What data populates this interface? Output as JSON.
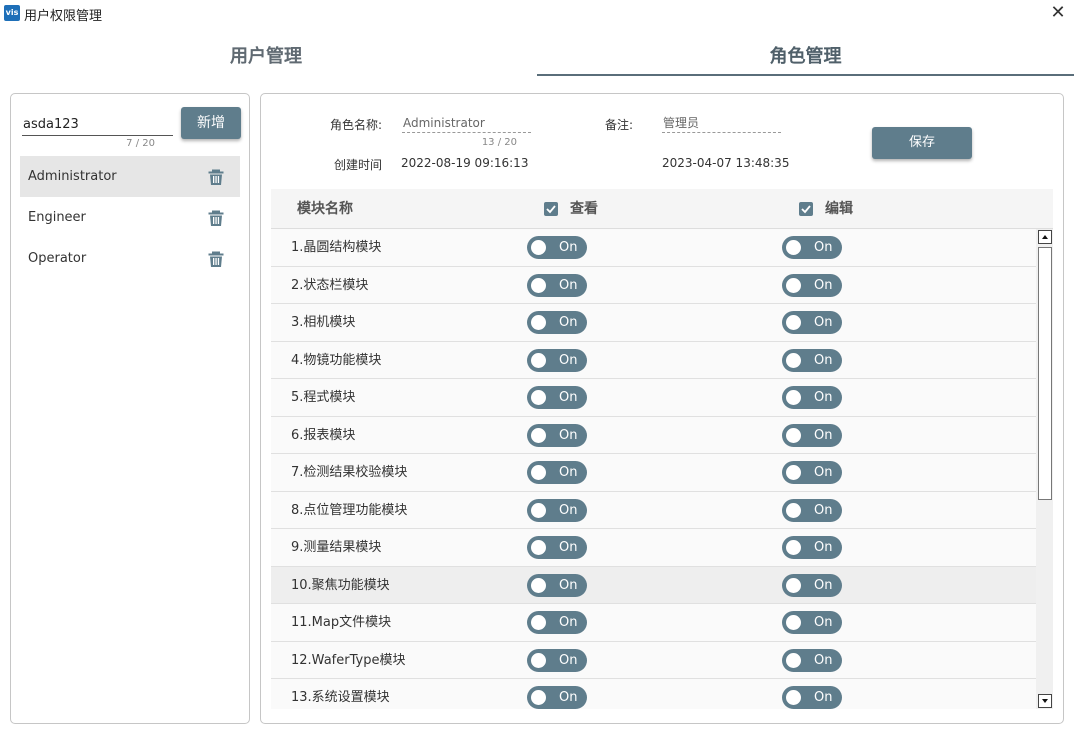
{
  "window": {
    "icon_text": "vis",
    "title": "用户权限管理",
    "close_symbol": "✕"
  },
  "tabs": [
    {
      "label": "用户管理",
      "active": false
    },
    {
      "label": "角色管理",
      "active": true
    }
  ],
  "left_panel": {
    "input_value": "asda123",
    "input_counter": "7 / 20",
    "add_button_label": "新增",
    "roles": [
      {
        "name": "Administrator",
        "selected": true
      },
      {
        "name": "Engineer",
        "selected": false
      },
      {
        "name": "Operator",
        "selected": false
      }
    ]
  },
  "form": {
    "role_name_label": "角色名称:",
    "role_name_value": "Administrator",
    "role_name_counter": "13 / 20",
    "remark_label": "备注:",
    "remark_value": "管理员",
    "created_label": "创建时间",
    "created_value": "2022-08-19 09:16:13",
    "updated_value": "2023-04-07 13:48:35",
    "save_button_label": "保存"
  },
  "table": {
    "col_module": "模块名称",
    "col_view": "查看",
    "col_edit": "编辑",
    "toggle_label": "On",
    "rows": [
      {
        "name": "1.晶圆结构模块",
        "view": "On",
        "edit": "On"
      },
      {
        "name": "2.状态栏模块",
        "view": "On",
        "edit": "On"
      },
      {
        "name": "3.相机模块",
        "view": "On",
        "edit": "On"
      },
      {
        "name": "4.物镜功能模块",
        "view": "On",
        "edit": "On"
      },
      {
        "name": "5.程式模块",
        "view": "On",
        "edit": "On"
      },
      {
        "name": "6.报表模块",
        "view": "On",
        "edit": "On"
      },
      {
        "name": "7.检测结果校验模块",
        "view": "On",
        "edit": "On"
      },
      {
        "name": "8.点位管理功能模块",
        "view": "On",
        "edit": "On"
      },
      {
        "name": "9.测量结果模块",
        "view": "On",
        "edit": "On"
      },
      {
        "name": "10.聚焦功能模块",
        "view": "On",
        "edit": "On"
      },
      {
        "name": "11.Map文件模块",
        "view": "On",
        "edit": "On"
      },
      {
        "name": "12.WaferType模块",
        "view": "On",
        "edit": "On"
      },
      {
        "name": "13.系统设置模块",
        "view": "On",
        "edit": "On"
      }
    ]
  },
  "colors": {
    "accent": "#5f7d8c",
    "selected_row": "#e6e6e6"
  }
}
